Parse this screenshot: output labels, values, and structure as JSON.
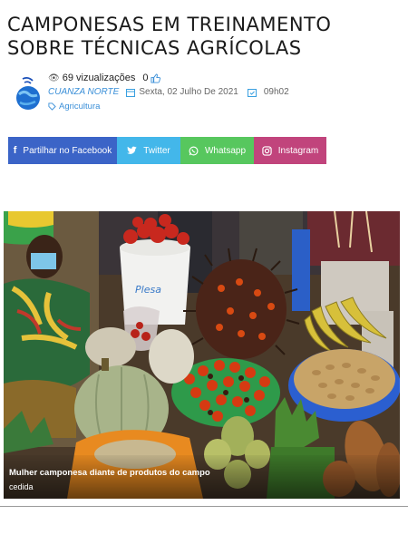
{
  "article": {
    "title": "CAMPONESAS EM TREINAMENTO SOBRE TÉCNICAS AGRÍCOLAS"
  },
  "meta": {
    "views": "69 vizualizações",
    "likes": "0",
    "author": "CUANZA NORTE",
    "date": "Sexta, 02 Julho De 2021",
    "time": "09h02",
    "category": "Agricultura",
    "icons": {
      "views": "eye-icon",
      "likes": "thumbs-up-icon",
      "date": "calendar-icon",
      "time": "clock-icon",
      "category": "tag-icon"
    }
  },
  "share": {
    "facebook": {
      "label": "Partilhar no Facebook",
      "icon": "facebook-icon",
      "color": "#3b64c7"
    },
    "twitter": {
      "label": "Twitter",
      "icon": "twitter-icon",
      "color": "#43b7ea"
    },
    "whatsapp": {
      "label": "Whatsapp",
      "icon": "whatsapp-icon",
      "color": "#57c75e"
    },
    "instagram": {
      "label": "Instagram",
      "icon": "instagram-icon",
      "color": "#c1447c"
    }
  },
  "photo": {
    "caption": "Mulher camponesa diante de produtos do campo",
    "credit": "cedida"
  }
}
